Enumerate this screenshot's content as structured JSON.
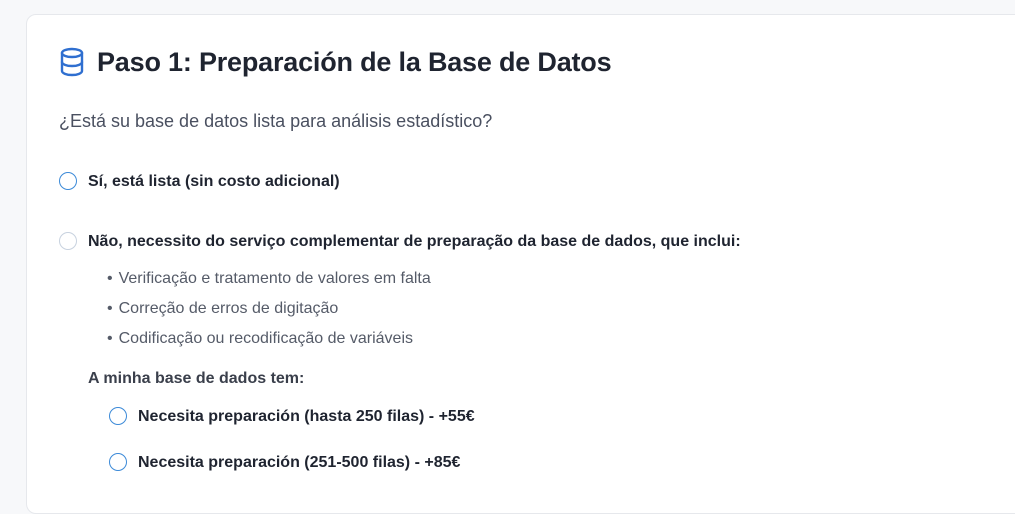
{
  "step": {
    "title": "Paso 1: Preparación de la Base de Datos",
    "icon": "database-icon",
    "accent_color": "#3c8ad8"
  },
  "question": "¿Está su base de datos lista para análisis estadístico?",
  "options": [
    {
      "label": "Sí, está lista (sin costo adicional)"
    },
    {
      "label": "Não, necessito do serviço complementar de preparação da base de dados, que inclui:",
      "includes": [
        "Verificação e tratamento de valores em falta",
        "Correção de erros de digitação",
        "Codificação ou recodificação de variáveis"
      ],
      "sub_heading": "A minha base de dados tem:",
      "sub_options": [
        {
          "label": "Necesita preparación (hasta 250 filas) - +55€"
        },
        {
          "label": "Necesita preparación (251-500 filas) - +85€"
        }
      ]
    }
  ]
}
